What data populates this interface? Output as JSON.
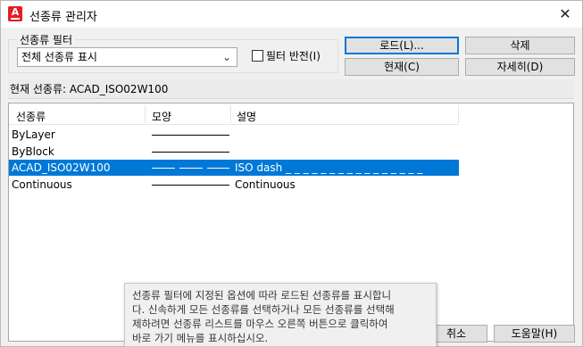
{
  "window": {
    "title": "선종류 관리자",
    "close_glyph": "✕",
    "app_icon_letter": "A"
  },
  "filter": {
    "legend": "선종류 필터",
    "selected": "전체 선종류 표시",
    "invert_label": "필터 반전(I)"
  },
  "buttons": {
    "load": "로드(L)...",
    "delete": "삭제",
    "current": "현재(C)",
    "details": "자세히(D)",
    "cancel": "취소",
    "help": "도움말(H)"
  },
  "current_linetype": "현재 선종류:  ACAD_ISO02W100",
  "list": {
    "headers": [
      "선종류",
      "모양",
      "설명"
    ],
    "rows": [
      {
        "name": "ByLayer",
        "appearance": "solid",
        "description": ""
      },
      {
        "name": "ByBlock",
        "appearance": "solid",
        "description": ""
      },
      {
        "name": "ACAD_ISO02W100",
        "appearance": "dashed",
        "description": "ISO dash _ _ _ _ _ _ _ _ _ _ _ _ _ _ _ _",
        "selected": true
      },
      {
        "name": "Continuous",
        "appearance": "solid",
        "description": "Continuous"
      }
    ]
  },
  "tooltip": {
    "lines": [
      "선종류 필터에 지정된 옵션에 따라 로드된 선종류를 표시합니",
      "다. 신속하게 모든 선종류를 선택하거나 모든 선종류를 선택해",
      "제하려면 선종류 리스트를 마우스 오른쪽 버튼으로 클릭하여",
      "바로 가기 메뉴를 표시하십시오."
    ]
  },
  "colors": {
    "selection": "#0078d7",
    "app_icon": "#e51e26"
  }
}
